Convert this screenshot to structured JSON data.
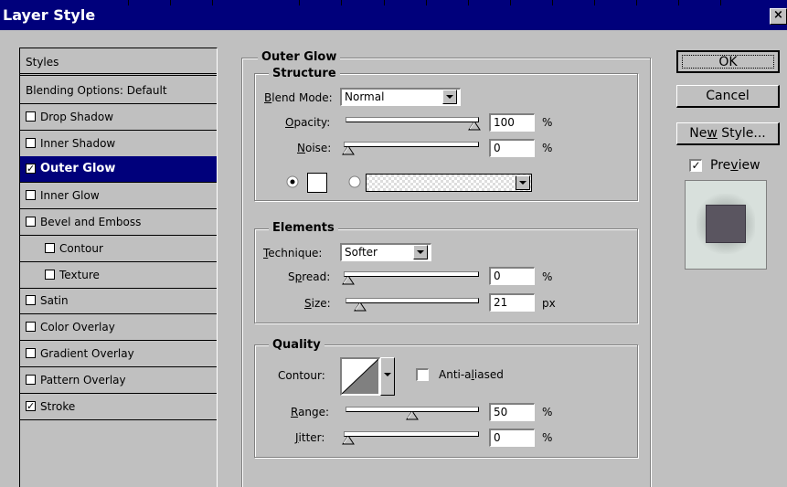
{
  "window": {
    "title": "Layer Style",
    "close_glyph": "×"
  },
  "styles_panel": {
    "header": "Styles",
    "items": [
      {
        "label": "Blending Options: Default",
        "checkbox": false,
        "checked": false,
        "indent": false,
        "selected": false
      },
      {
        "label": "Drop Shadow",
        "checkbox": true,
        "checked": false,
        "indent": false,
        "selected": false
      },
      {
        "label": "Inner Shadow",
        "checkbox": true,
        "checked": false,
        "indent": false,
        "selected": false
      },
      {
        "label": "Outer Glow",
        "checkbox": true,
        "checked": true,
        "indent": false,
        "selected": true
      },
      {
        "label": "Inner Glow",
        "checkbox": true,
        "checked": false,
        "indent": false,
        "selected": false
      },
      {
        "label": "Bevel and Emboss",
        "checkbox": true,
        "checked": false,
        "indent": false,
        "selected": false
      },
      {
        "label": "Contour",
        "checkbox": true,
        "checked": false,
        "indent": true,
        "selected": false
      },
      {
        "label": "Texture",
        "checkbox": true,
        "checked": false,
        "indent": true,
        "selected": false
      },
      {
        "label": "Satin",
        "checkbox": true,
        "checked": false,
        "indent": false,
        "selected": false
      },
      {
        "label": "Color Overlay",
        "checkbox": true,
        "checked": false,
        "indent": false,
        "selected": false
      },
      {
        "label": "Gradient Overlay",
        "checkbox": true,
        "checked": false,
        "indent": false,
        "selected": false
      },
      {
        "label": "Pattern Overlay",
        "checkbox": true,
        "checked": false,
        "indent": false,
        "selected": false
      },
      {
        "label": "Stroke",
        "checkbox": true,
        "checked": true,
        "indent": false,
        "selected": false
      }
    ]
  },
  "outer_glow": {
    "title": "Outer Glow",
    "structure": {
      "title": "Structure",
      "blend_mode_label": "Blend Mode:",
      "blend_mode_value": "Normal",
      "opacity_label": "Opacity:",
      "opacity_value": "100",
      "opacity_fraction": 1.0,
      "opacity_unit": "%",
      "noise_label": "Noise:",
      "noise_value": "0",
      "noise_fraction": 0.0,
      "noise_unit": "%",
      "fill_mode": "solid-color",
      "glow_color": "#ffffff"
    },
    "elements": {
      "title": "Elements",
      "technique_label": "Technique:",
      "technique_value": "Softer",
      "spread_label": "Spread:",
      "spread_value": "0",
      "spread_fraction": 0.0,
      "spread_unit": "%",
      "size_label": "Size:",
      "size_value": "21",
      "size_fraction": 0.08,
      "size_unit": "px"
    },
    "quality": {
      "title": "Quality",
      "contour_label": "Contour:",
      "anti_aliased_label": "Anti-aliased",
      "anti_aliased_checked": false,
      "range_label": "Range:",
      "range_value": "50",
      "range_fraction": 0.5,
      "range_unit": "%",
      "jitter_label": "Jitter:",
      "jitter_value": "0",
      "jitter_fraction": 0.0,
      "jitter_unit": "%"
    }
  },
  "buttons": {
    "ok": "OK",
    "cancel": "Cancel",
    "new_style": "New Style...",
    "preview_label": "Preview",
    "preview_checked": true
  },
  "colors": {
    "titlebar": "#00007b",
    "selection": "#00007b",
    "face": "#c0c0c0",
    "preview_swatch": "#5a5560"
  }
}
